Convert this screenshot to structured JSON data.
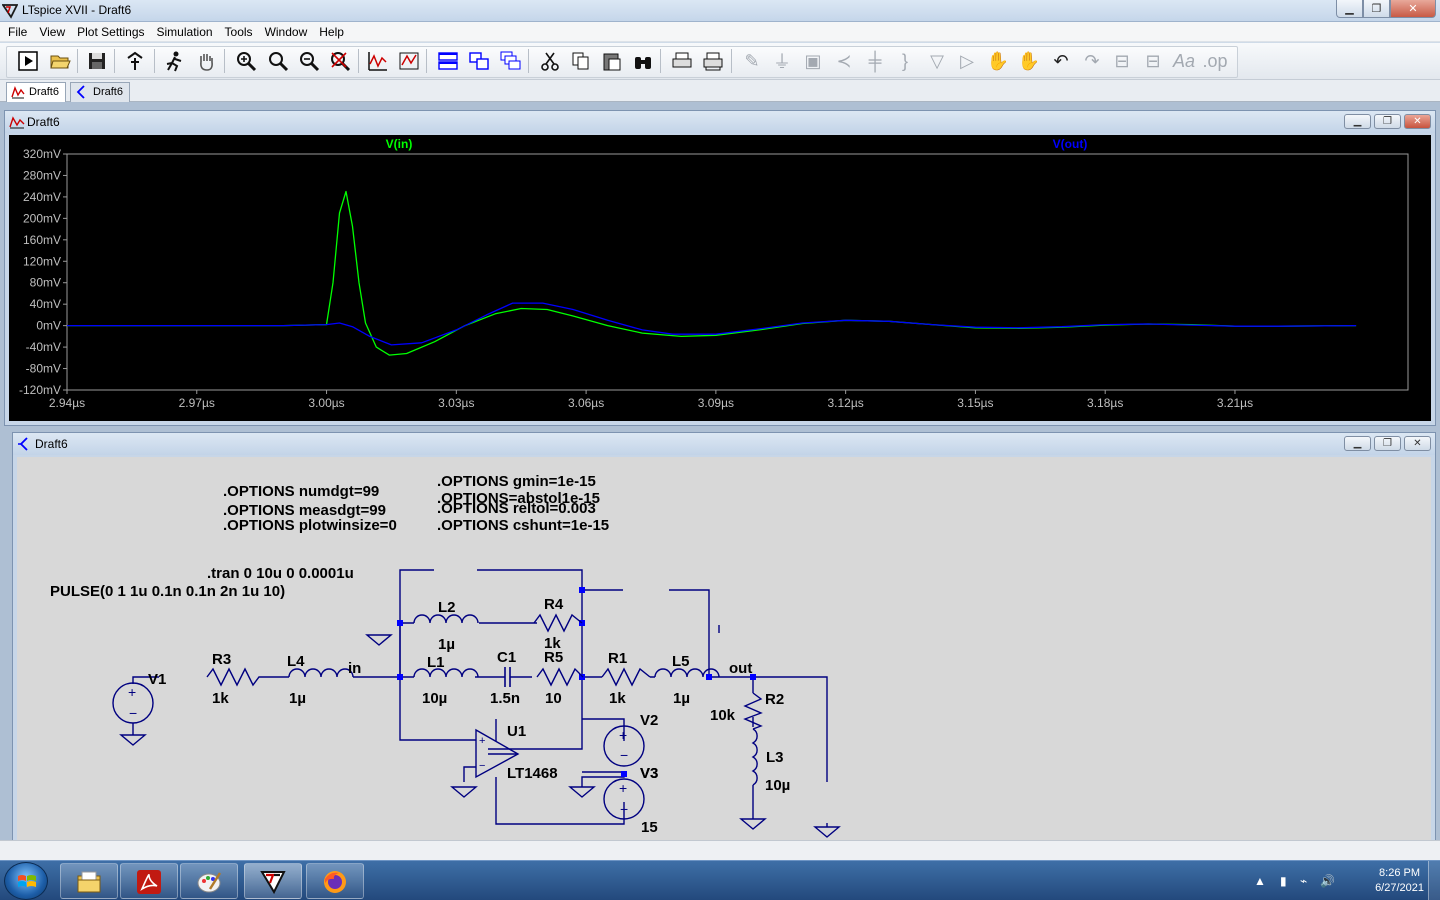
{
  "window": {
    "title": "LTspice XVII - Draft6"
  },
  "menu": [
    "File",
    "View",
    "Plot Settings",
    "Simulation",
    "Tools",
    "Window",
    "Help"
  ],
  "tabs": [
    {
      "label": "Draft6",
      "kind": "waveform",
      "active": true
    },
    {
      "label": "Draft6",
      "kind": "schematic",
      "active": false
    }
  ],
  "waveform_window": {
    "title": "Draft6",
    "traces": [
      {
        "label": "V(in)",
        "color": "#00ff00"
      },
      {
        "label": "V(out)",
        "color": "#0000ff"
      }
    ]
  },
  "chart_data": {
    "type": "line",
    "xlabel": "",
    "ylabel": "",
    "xlim": [
      2.94,
      3.25
    ],
    "ylim": [
      -120,
      320
    ],
    "x_ticks": [
      "2.94µs",
      "2.97µs",
      "3.00µs",
      "3.03µs",
      "3.06µs",
      "3.09µs",
      "3.12µs",
      "3.15µs",
      "3.18µs",
      "3.21µs"
    ],
    "x_tick_values": [
      2.94,
      2.97,
      3.0,
      3.03,
      3.06,
      3.09,
      3.12,
      3.15,
      3.18,
      3.21
    ],
    "y_ticks": [
      "320mV",
      "280mV",
      "240mV",
      "200mV",
      "160mV",
      "120mV",
      "80mV",
      "40mV",
      "0mV",
      "-40mV",
      "-80mV",
      "-120mV"
    ],
    "y_tick_values": [
      320,
      280,
      240,
      200,
      160,
      120,
      80,
      40,
      0,
      -40,
      -80,
      -120
    ],
    "grid": false,
    "background": "#000000",
    "series": [
      {
        "name": "V(in)",
        "color": "#00ff00",
        "x": [
          2.94,
          2.99,
          3.0,
          3.0015,
          3.003,
          3.0045,
          3.006,
          3.0075,
          3.009,
          3.0115,
          3.0145,
          3.0185,
          3.025,
          3.032,
          3.039,
          3.045,
          3.051,
          3.057,
          3.065,
          3.073,
          3.082,
          3.09,
          3.1,
          3.11,
          3.12,
          3.13,
          3.14,
          3.15,
          3.16,
          3.17,
          3.18,
          3.19,
          3.2,
          3.21,
          3.22,
          3.238
        ],
        "y": [
          0,
          0,
          2,
          80,
          210,
          250,
          185,
          80,
          5,
          -40,
          -55,
          -52,
          -30,
          0,
          22,
          32,
          30,
          18,
          0,
          -14,
          -20,
          -18,
          -8,
          4,
          10,
          8,
          2,
          -4,
          -5,
          -3,
          1,
          3,
          2,
          -1,
          -1,
          0
        ]
      },
      {
        "name": "V(out)",
        "color": "#0000ff",
        "x": [
          2.94,
          2.99,
          3.0,
          3.003,
          3.006,
          3.01,
          3.015,
          3.022,
          3.03,
          3.037,
          3.043,
          3.05,
          3.057,
          3.065,
          3.073,
          3.08,
          3.09,
          3.1,
          3.11,
          3.12,
          3.13,
          3.14,
          3.15,
          3.16,
          3.17,
          3.18,
          3.19,
          3.2,
          3.21,
          3.22,
          3.238
        ],
        "y": [
          0,
          0,
          2,
          5,
          -2,
          -20,
          -36,
          -32,
          -8,
          20,
          42,
          42,
          30,
          10,
          -8,
          -16,
          -16,
          -6,
          5,
          10,
          8,
          2,
          -3,
          -4,
          -2,
          2,
          3,
          1,
          -1,
          -1,
          0
        ]
      }
    ]
  },
  "schematic_window": {
    "title": "Draft6",
    "directives": {
      "numdgt": ".OPTIONS numdgt=99",
      "measdgt": ".OPTIONS measdgt=99",
      "plotwinsize": ".OPTIONS plotwinsize=0",
      "gmin": ".OPTIONS gmin=1e-15",
      "abstol": ".OPTIONS=abstol1e-15",
      "reltol": ".OPTIONS reltol=0.003",
      "cshunt": ".OPTIONS cshunt=1e-15",
      "tran": ".tran 0 10u 0 0.0001u",
      "pulse": "PULSE(0 1 1u 0.1n 0.1n 2n 1u 10)"
    },
    "components": {
      "V1": {
        "name": "V1"
      },
      "R3": {
        "name": "R3",
        "value": "1k"
      },
      "L4": {
        "name": "L4",
        "value": "1µ"
      },
      "L2": {
        "name": "L2",
        "value": "1µ"
      },
      "R4": {
        "name": "R4",
        "value": "1k"
      },
      "L1": {
        "name": "L1",
        "value": "10µ"
      },
      "C1": {
        "name": "C1",
        "value": "1.5n"
      },
      "R5": {
        "name": "R5",
        "value": "10"
      },
      "R1": {
        "name": "R1",
        "value": "1k"
      },
      "L5": {
        "name": "L5",
        "value": "1µ"
      },
      "R2": {
        "name": "R2",
        "value": "10k"
      },
      "L3": {
        "name": "L3",
        "value": "10µ"
      },
      "U1": {
        "name": "U1",
        "model": "LT1468"
      },
      "V2": {
        "name": "V2"
      },
      "V3": {
        "name": "V3",
        "value": "15"
      },
      "V3label": {
        "overlap": "V3"
      }
    },
    "nets": {
      "in": "in",
      "out": "out"
    }
  },
  "taskbar": {
    "time": "8:26 PM",
    "date": "6/27/2021"
  }
}
